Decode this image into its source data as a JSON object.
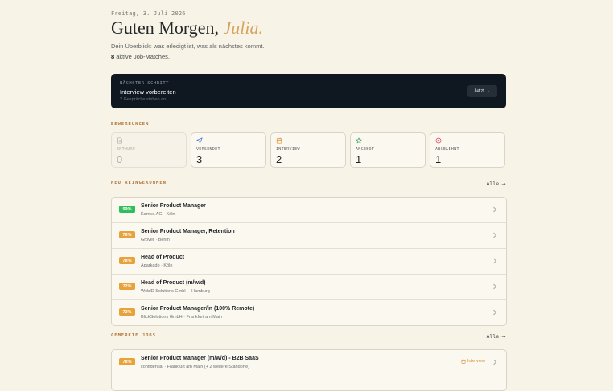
{
  "header": {
    "date": "Freitag, 3. Juli 2026",
    "greeting": "Guten Morgen,",
    "name": "Julia.",
    "subtitle": "Dein Überblick: was erledigt ist, was als nächstes kommt.",
    "match_count": "8",
    "match_label": "aktive Job-Matches."
  },
  "next_step": {
    "label": "NÄCHSTER SCHRITT",
    "title": "Interview vorbereiten",
    "subtitle": "2 Gespräche stehen an",
    "button": "Jetzt →"
  },
  "applications": {
    "section_label": "BEWERBUNGEN",
    "stats": [
      {
        "label": "ENTWURF",
        "count": "0",
        "icon": "document-icon",
        "color": "#b2aea4"
      },
      {
        "label": "VERSENDET",
        "count": "3",
        "icon": "send-icon",
        "color": "#3b6fd8"
      },
      {
        "label": "INTERVIEW",
        "count": "2",
        "icon": "calendar-icon",
        "color": "#e08a2c"
      },
      {
        "label": "ANGEBOT",
        "count": "1",
        "icon": "star-icon",
        "color": "#2f9e58"
      },
      {
        "label": "ABGELEHNT",
        "count": "1",
        "icon": "x-circle-icon",
        "color": "#d8465a"
      }
    ]
  },
  "new_jobs": {
    "section_label": "NEU REINGEKOMMEN",
    "all_link": "Alle ⟶",
    "items": [
      {
        "score": "99%",
        "title": "Senior Product Manager",
        "meta": "Karriva AG · Köln"
      },
      {
        "score": "76%",
        "title": "Senior Product Manager, Retention",
        "meta": "Grover · Berlin"
      },
      {
        "score": "78%",
        "title": "Head of Product",
        "meta": "Aparkado · Köln"
      },
      {
        "score": "72%",
        "title": "Head of Product (m/w/d)",
        "meta": "WebID Solutions GmbH · Hamburg"
      },
      {
        "score": "72%",
        "title": "Senior Product Manager/in (100% Remote)",
        "meta": "BlickSolutions GmbH · Frankfurt am Main"
      }
    ]
  },
  "saved_jobs": {
    "section_label": "GEMERKTE JOBS",
    "all_link": "Alle ⟶",
    "items": [
      {
        "score": "78%",
        "title": "Senior Product Manager (m/w/d) - B2B SaaS",
        "meta": "confidential · Frankfurt am Main (+ 2 weitere Standorte)",
        "status": "Interview"
      }
    ]
  },
  "colors": {
    "background": "#f8f3e7",
    "accent": "#d6a35d",
    "dark_card": "#0f1720",
    "badge_green": "#2fbf5a",
    "badge_orange": "#e9a23b"
  }
}
